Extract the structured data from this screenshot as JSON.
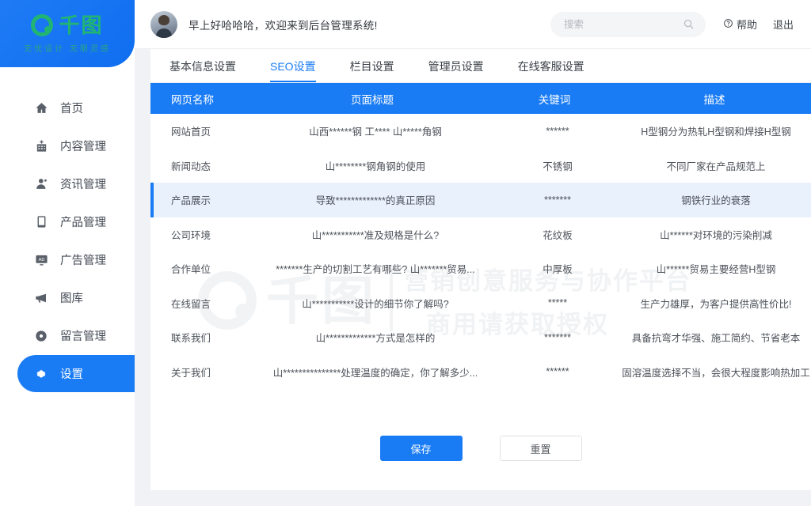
{
  "brand": {
    "logo_text": "千图",
    "logo_tagline": "无忧设计 无限灵感",
    "logo_icon": "qiantu-circle-icon",
    "accent": "#1a7cf5",
    "green": "#21b573"
  },
  "sidebar": {
    "items": [
      {
        "label": "首页",
        "icon": "home-icon",
        "active": false
      },
      {
        "label": "内容管理",
        "icon": "building-icon",
        "active": false
      },
      {
        "label": "资讯管理",
        "icon": "user-icon",
        "active": false
      },
      {
        "label": "产品管理",
        "icon": "tablet-icon",
        "active": false
      },
      {
        "label": "广告管理",
        "icon": "ad-monitor-icon",
        "active": false
      },
      {
        "label": "图库",
        "icon": "megaphone-icon",
        "active": false
      },
      {
        "label": "留言管理",
        "icon": "disc-icon",
        "active": false
      },
      {
        "label": "设置",
        "icon": "gear-icon",
        "active": true
      }
    ]
  },
  "topbar": {
    "greeting": "早上好哈哈哈，欢迎来到后台管理系统!",
    "avatar": "user-avatar",
    "search": {
      "value": "",
      "placeholder": "搜索",
      "icon": "search-icon"
    },
    "help_label": "帮助",
    "help_icon": "question-circle-icon",
    "logout_label": "退出"
  },
  "tabs": [
    {
      "label": "基本信息设置",
      "active": false
    },
    {
      "label": "SEO设置",
      "active": true
    },
    {
      "label": "栏目设置",
      "active": false
    },
    {
      "label": "管理员设置",
      "active": false
    },
    {
      "label": "在线客服设置",
      "active": false
    }
  ],
  "table": {
    "columns": [
      "网页名称",
      "页面标题",
      "关键词",
      "描述"
    ],
    "rows": [
      {
        "name": "网站首页",
        "title": "山西******钢 工**** 山*****角钢",
        "keyword": "******",
        "desc": "H型钢分为热轧H型钢和焊接H型钢",
        "selected": false
      },
      {
        "name": "新闻动态",
        "title": "山********钢角钢的使用",
        "keyword": "不锈钢",
        "desc": "不同厂家在产品规范上",
        "selected": false
      },
      {
        "name": "产品展示",
        "title": "导致*************的真正原因",
        "keyword": "*******",
        "desc": "钢铁行业的衰落",
        "selected": true
      },
      {
        "name": "公司环境",
        "title": "山***********准及规格是什么?",
        "keyword": "花纹板",
        "desc": "山******对环境的污染削减",
        "selected": false
      },
      {
        "name": "合作单位",
        "title": "*******生产的切割工艺有哪些? 山*******贸易...",
        "keyword": "中厚板",
        "desc": "山******贸易主要经营H型钢",
        "selected": false
      },
      {
        "name": "在线留言",
        "title": "山***********设计的细节你了解吗?",
        "keyword": "*****",
        "desc": "生产力雄厚，为客户提供高性价比!",
        "selected": false
      },
      {
        "name": "联系我们",
        "title": "山*************方式是怎样的",
        "keyword": "*******",
        "desc": "具备抗弯才华强、施工简约、节省老本",
        "selected": false
      },
      {
        "name": "关于我们",
        "title": "山***************处理温度的确定，你了解多少...",
        "keyword": "******",
        "desc": "固溶温度选择不当，会很大程度影响热加工",
        "selected": false
      }
    ]
  },
  "actions": {
    "save_label": "保存",
    "reset_label": "重置"
  },
  "watermark": {
    "brand": "千图",
    "line1": "营销创意服务与协作平台",
    "line2": "商用请获取授权"
  }
}
